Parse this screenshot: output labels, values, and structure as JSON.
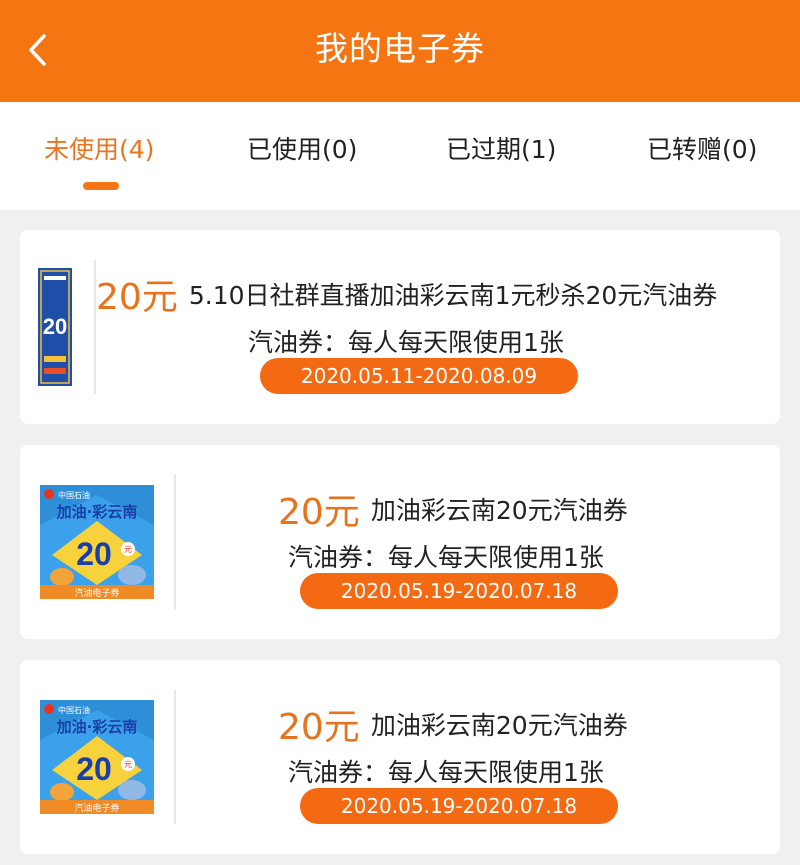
{
  "header": {
    "title": "我的电子券",
    "back_icon": "chevron-left-icon",
    "color": "#f57512"
  },
  "tabs": [
    {
      "label": "未使用(4)",
      "active": true
    },
    {
      "label": "已使用(0)",
      "active": false
    },
    {
      "label": "已过期(1)",
      "active": false
    },
    {
      "label": "已转赠(0)",
      "active": false
    }
  ],
  "coupons": [
    {
      "price": "20元",
      "name": "5.10日社群直播加油彩云南1元秒杀20元汽油券",
      "rule": "汽油券：每人每天限使用1张",
      "validity": "2020.05.11-2020.08.09",
      "thumb": {
        "value": "20"
      }
    },
    {
      "price": "20元",
      "name": "加油彩云南20元汽油券",
      "rule": "汽油券：每人每天限使用1张",
      "validity": "2020.05.19-2020.07.18",
      "thumb": {
        "brand": "中国石油",
        "slogan": "加油·彩云南",
        "value": "20",
        "unit": "元",
        "caption": "汽油电子券"
      }
    },
    {
      "price": "20元",
      "name": "加油彩云南20元汽油券",
      "rule": "汽油券：每人每天限使用1张",
      "validity": "2020.05.19-2020.07.18",
      "thumb": {
        "brand": "中国石油",
        "slogan": "加油·彩云南",
        "value": "20",
        "unit": "元",
        "caption": "汽油电子券"
      }
    }
  ],
  "colors": {
    "accent": "#f57512",
    "price": "#e8731d",
    "badge": "#f36a12",
    "background": "#f0f0f0"
  }
}
